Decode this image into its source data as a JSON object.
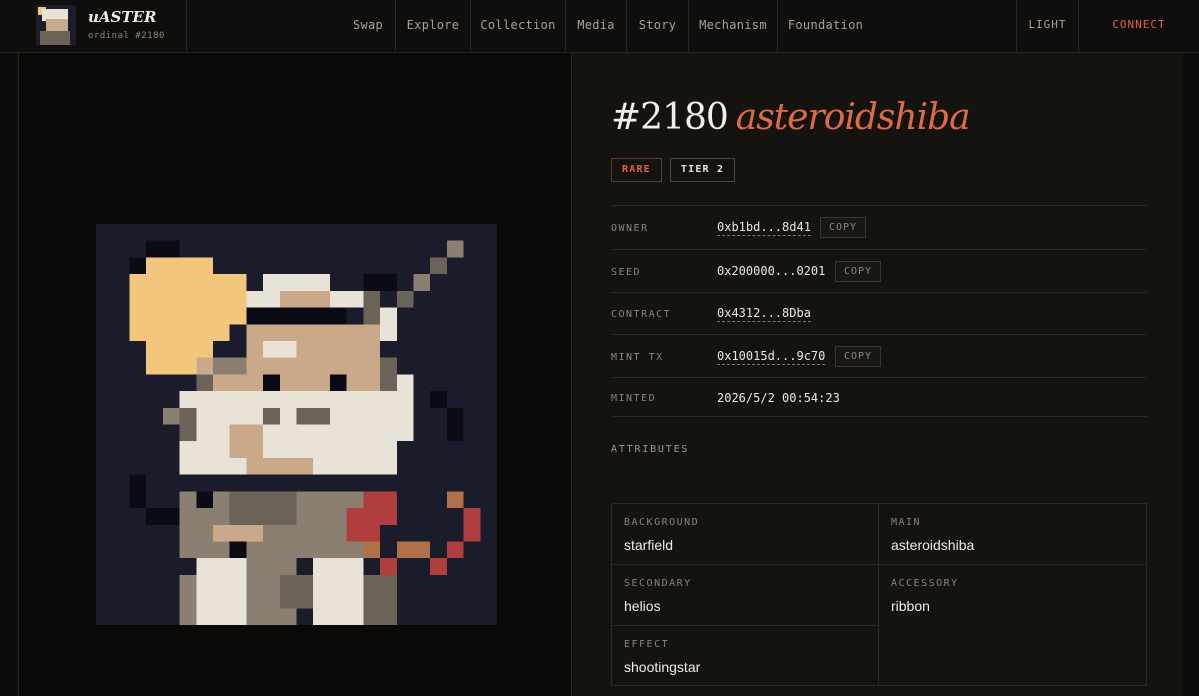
{
  "header": {
    "brand_name": "uASTER",
    "brand_sub": "ordinal #2180",
    "nav": [
      "Swap",
      "Explore",
      "Collection",
      "Media",
      "Story",
      "Mechanism",
      "Foundation"
    ],
    "theme_label": "LIGHT",
    "connect_label": "CONNECT"
  },
  "item": {
    "number": "#2180",
    "name": "asteroidshiba",
    "tags": [
      "RARE",
      "TIER 2"
    ]
  },
  "details": [
    {
      "label": "OWNER",
      "value": "0xb1bd...8d41",
      "copy": "COPY"
    },
    {
      "label": "SEED",
      "value": "0x200000...0201",
      "copy": "COPY"
    },
    {
      "label": "CONTRACT",
      "value": "0x4312...8Dba"
    },
    {
      "label": "MINT TX",
      "value": "0x10015d...9c70",
      "copy": "COPY"
    },
    {
      "label": "MINTED",
      "value": "2026/5/2 00:54:23"
    }
  ],
  "attributes": {
    "heading": "ATTRIBUTES",
    "items": [
      {
        "key": "BACKGROUND",
        "value": "starfield"
      },
      {
        "key": "MAIN",
        "value": "asteroidshiba"
      },
      {
        "key": "SECONDARY",
        "value": "helios"
      },
      {
        "key": "ACCESSORY",
        "value": "ribbon"
      },
      {
        "key": "EFFECT",
        "value": "shootingstar"
      }
    ]
  },
  "colors": {
    "accent": "#e4613e",
    "art_background": "#1a1c2c"
  }
}
